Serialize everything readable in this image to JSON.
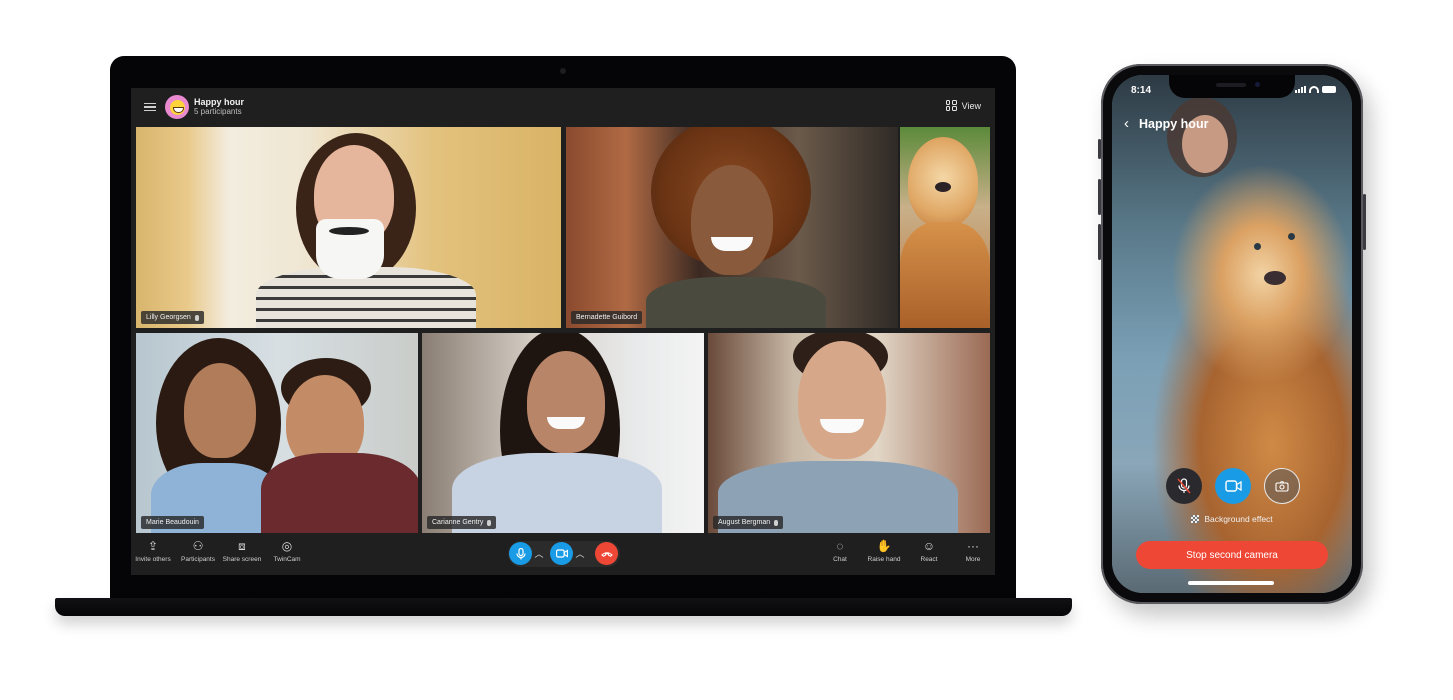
{
  "laptop": {
    "call": {
      "title": "Happy hour",
      "subtitle": "5 participants",
      "avatar_icon": "grinning-face-icon",
      "view_label": "View"
    },
    "participants": [
      {
        "name": "Lilly Georgsen",
        "mic": true
      },
      {
        "name": "Bernadette Guibord",
        "mic": false
      },
      {
        "name": "",
        "mic": false,
        "note": "dog second camera"
      },
      {
        "name": "Marie Beaudouin",
        "mic": false
      },
      {
        "name": "Carianne Gentry",
        "mic": true
      },
      {
        "name": "August Bergman",
        "mic": true
      }
    ],
    "toolbar_left": [
      {
        "label": "Invite others",
        "icon": "share-upload-icon"
      },
      {
        "label": "Participants",
        "icon": "participants-icon"
      },
      {
        "label": "Share screen",
        "icon": "share-screen-icon"
      },
      {
        "label": "TwinCam",
        "icon": "twincam-icon"
      }
    ],
    "toolbar_right": [
      {
        "label": "Chat",
        "icon": "chat-icon"
      },
      {
        "label": "Raise hand",
        "icon": "raise-hand-icon"
      },
      {
        "label": "React",
        "icon": "react-icon"
      },
      {
        "label": "More",
        "icon": "more-icon"
      }
    ],
    "colors": {
      "accent": "#1a9be6",
      "end_call": "#ef4735",
      "screen_bg": "#1f1f1f"
    }
  },
  "phone": {
    "status_time": "8:14",
    "title": "Happy hour",
    "background_effect_label": "Background effect",
    "stop_button_label": "Stop second camera",
    "controls": [
      {
        "name": "mic-muted",
        "state": "muted"
      },
      {
        "name": "video",
        "state": "on"
      },
      {
        "name": "switch-camera",
        "state": "off"
      }
    ]
  }
}
